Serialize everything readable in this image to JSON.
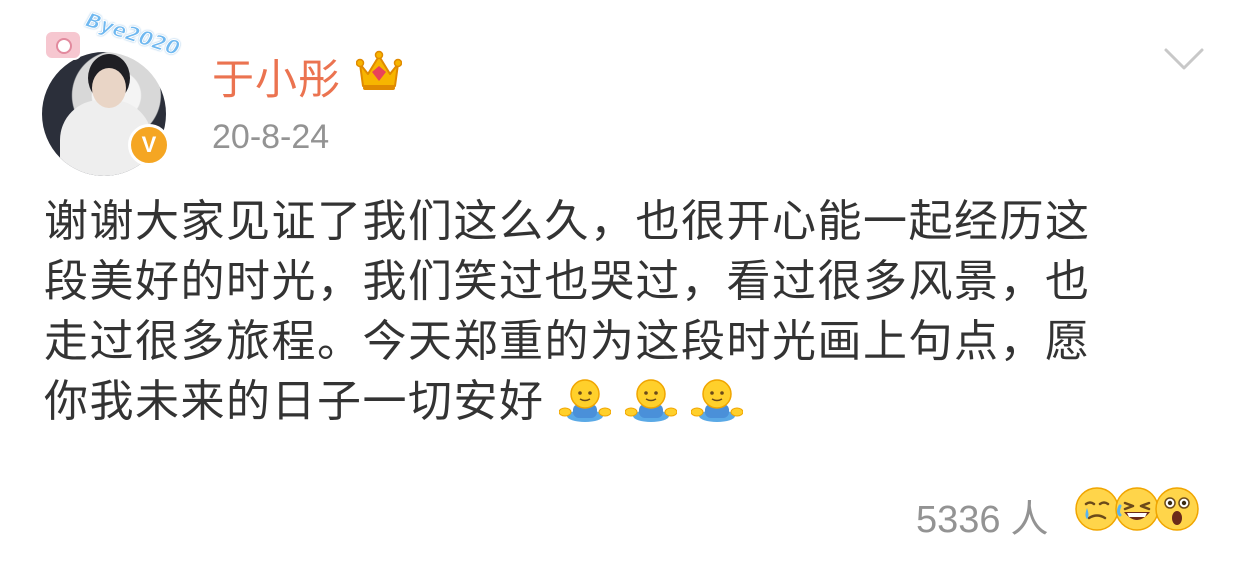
{
  "post": {
    "author": {
      "name": "于小彤",
      "avatar_frame_text": "Bye2020",
      "verified_icon": "verified-badge-icon",
      "member_icon": "crown-icon"
    },
    "date": "20-8-24",
    "text_lines": [
      "谢谢大家见证了我们这么久，也很开心能一起经历这",
      "段美好的时光，我们笑过也哭过，看过很多风景，也",
      "走过很多旅程。今天郑重的为这段时光画上句点，愿",
      "你我未来的日子一切安好"
    ],
    "inline_emojis": [
      "hug-emoji",
      "hug-emoji",
      "hug-emoji"
    ],
    "reactions": {
      "count": "5336",
      "unit": "人",
      "icons": [
        "tearful-emoji",
        "laughing-emoji",
        "surprised-emoji"
      ]
    },
    "more_menu_icon": "chevron-down-icon"
  },
  "colors": {
    "username": "#eb7350",
    "secondary_text": "#939393",
    "body_text": "#333333",
    "verified_badge": "#f5a623"
  }
}
